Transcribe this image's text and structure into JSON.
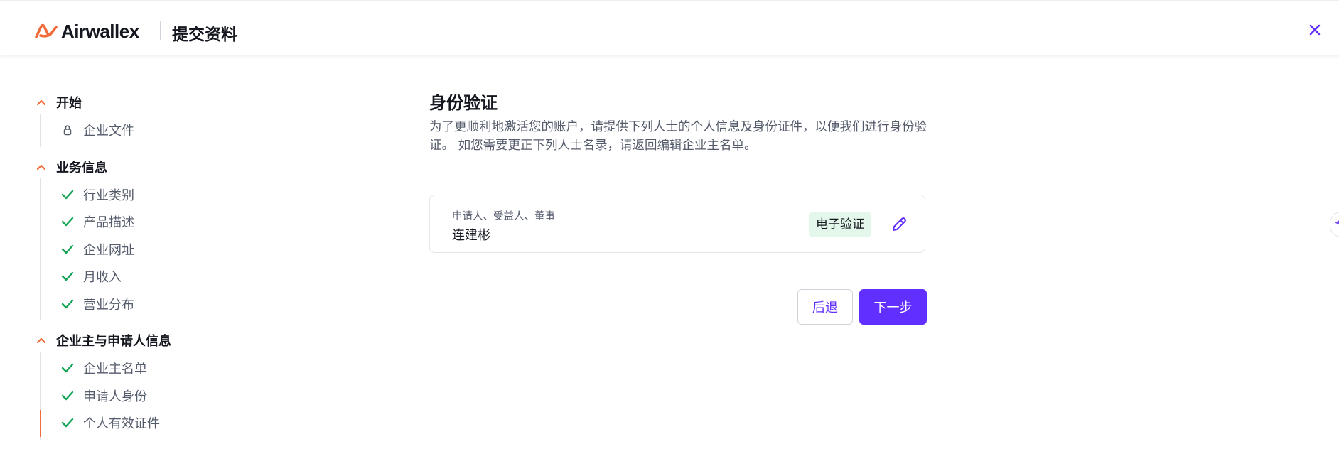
{
  "header": {
    "brand": "Airwallex",
    "title": "提交资料",
    "close_icon": "close-icon"
  },
  "colors": {
    "accent": "#612fff",
    "brand_orange": "#f26b3a",
    "check_green": "#12a454",
    "badge_bg": "#e3f7ea"
  },
  "sidebar": {
    "sections": [
      {
        "title": "开始",
        "items": [
          {
            "label": "企业文件",
            "icon": "lock-icon"
          }
        ]
      },
      {
        "title": "业务信息",
        "items": [
          {
            "label": "行业类别",
            "icon": "check-icon"
          },
          {
            "label": "产品描述",
            "icon": "check-icon"
          },
          {
            "label": "企业网址",
            "icon": "check-icon"
          },
          {
            "label": "月收入",
            "icon": "check-icon"
          },
          {
            "label": "营业分布",
            "icon": "check-icon"
          }
        ]
      },
      {
        "title": "企业主与申请人信息",
        "items": [
          {
            "label": "企业主名单",
            "icon": "check-icon"
          },
          {
            "label": "申请人身份",
            "icon": "check-icon"
          },
          {
            "label": "个人有效证件",
            "icon": "check-icon",
            "active": true
          }
        ]
      }
    ]
  },
  "main": {
    "title": "身份验证",
    "description": "为了更顺利地激活您的账户，请提供下列人士的个人信息及身份证件，以便我们进行身份验证。 如您需要更正下列人士名录，请返回编辑企业主名单。",
    "person": {
      "roles": "申请人、受益人、董事",
      "name": "连建彬",
      "badge": "电子验证",
      "edit_icon": "pencil-icon"
    },
    "back_label": "后退",
    "next_label": "下一步"
  }
}
